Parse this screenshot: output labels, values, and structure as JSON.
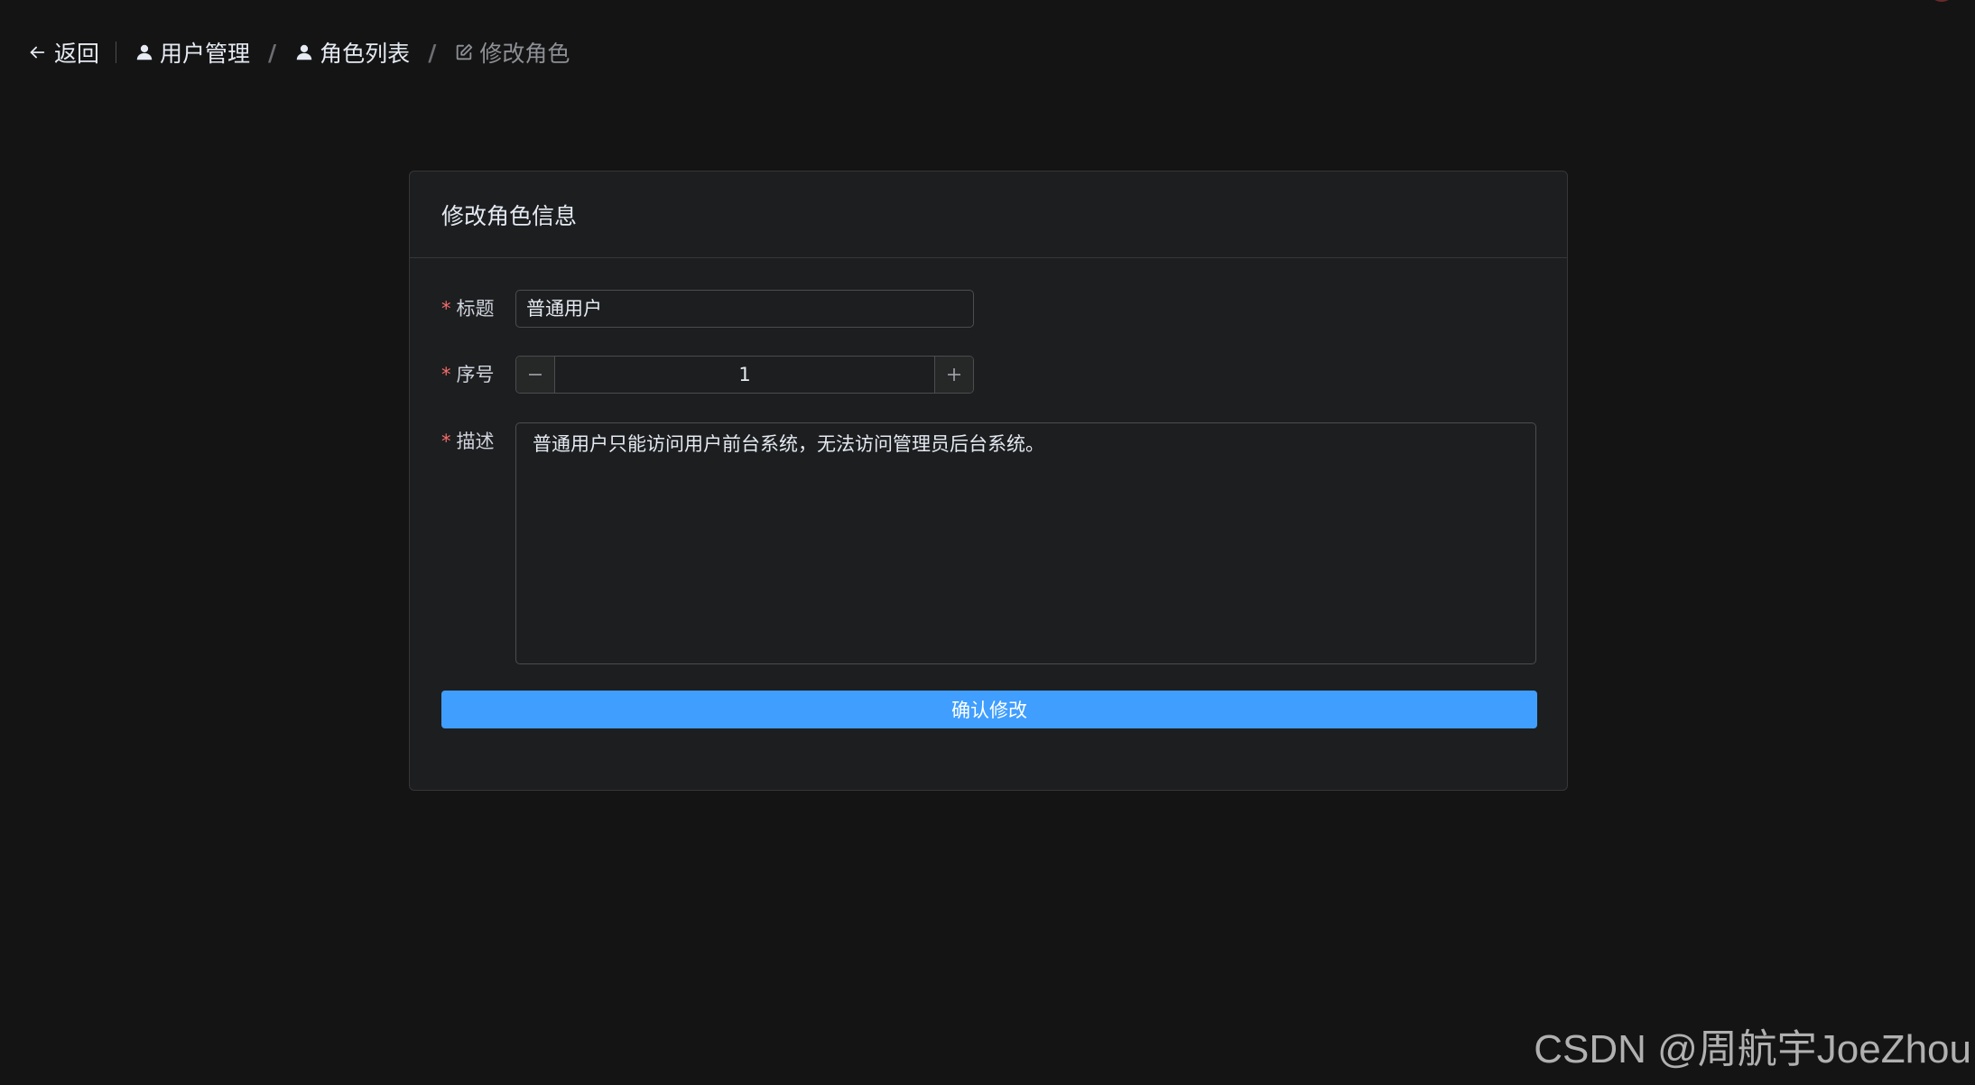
{
  "header": {
    "back_label": "返回",
    "breadcrumb": [
      {
        "label": "用户管理",
        "icon": "user-icon"
      },
      {
        "label": "角色列表",
        "icon": "user-icon"
      },
      {
        "label": "修改角色",
        "icon": "edit-icon"
      }
    ],
    "separator": "/"
  },
  "card": {
    "title": "修改角色信息"
  },
  "form": {
    "required_mark": "*",
    "title_label": "标题",
    "title_value": "普通用户",
    "order_label": "序号",
    "order_value": "1",
    "desc_label": "描述",
    "desc_value": "普通用户只能访问用户前台系统，无法访问管理员后台系统。",
    "submit_label": "确认修改"
  },
  "watermark": "CSDN @周航宇JoeZhou",
  "colors": {
    "background": "#141414",
    "card": "#1d1e1f",
    "primary": "#409eff",
    "required": "#f56c6c"
  }
}
